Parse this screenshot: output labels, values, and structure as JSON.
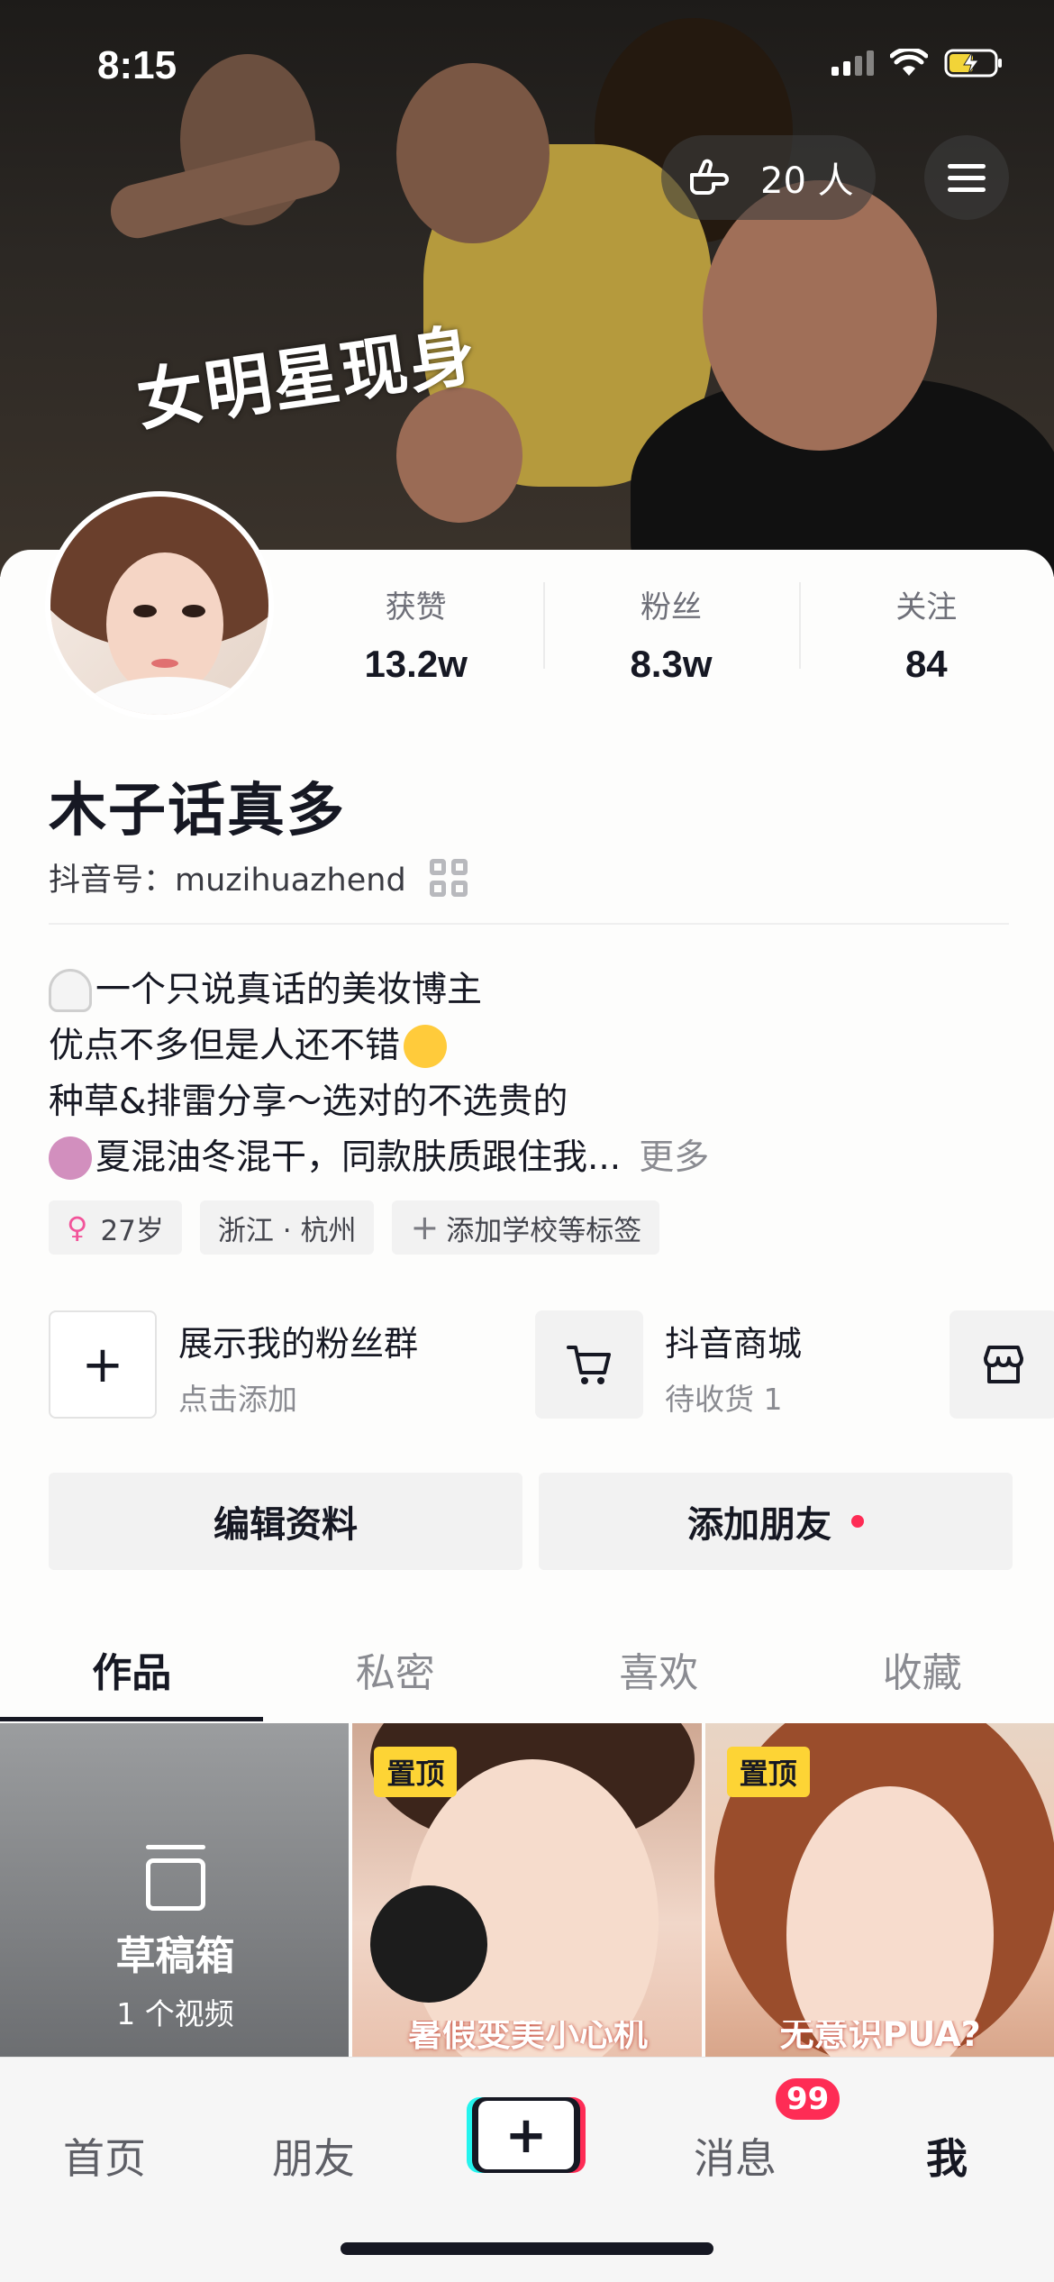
{
  "status_bar": {
    "time": "8:15"
  },
  "header": {
    "banner_caption": "女明星现身",
    "visitors": "20 人"
  },
  "stats": [
    {
      "label": "获赞",
      "value": "13.2w"
    },
    {
      "label": "粉丝",
      "value": "8.3w"
    },
    {
      "label": "关注",
      "value": "84"
    }
  ],
  "profile": {
    "nickname": "木子话真多",
    "douyin_id": "抖音号：muzihuazhend",
    "bio": [
      "一个只说真话的美妆博主",
      "优点不多但是人还不错",
      "种草&排雷分享～选对的不选贵的",
      "夏混油冬混干，同款肤质跟住我..."
    ],
    "bio_more": "更多",
    "tags": [
      "27岁",
      "浙江 · 杭州",
      "添加学校等标签"
    ]
  },
  "shortcuts": {
    "fan_group": {
      "title": "展示我的粉丝群",
      "sub": "点击添加"
    },
    "mall": {
      "title": "抖音商城",
      "sub": "待收货 1"
    }
  },
  "actions": {
    "edit": "编辑资料",
    "add_friend": "添加朋友"
  },
  "tabs": [
    "作品",
    "私密",
    "喜欢",
    "收藏"
  ],
  "grid": {
    "draft": {
      "title": "草稿箱",
      "count": "1 个视频"
    },
    "pinned_label": "置顶",
    "video1_caption": "暑假变美小心机",
    "video2_caption": "无意识PUA?"
  },
  "bottom_nav": {
    "home": "首页",
    "friends": "朋友",
    "messages": "消息",
    "messages_badge": "99",
    "me": "我"
  },
  "colors": {
    "accent": "#fe2c55",
    "pin": "#fdd435",
    "cyan": "#25f4ee"
  }
}
